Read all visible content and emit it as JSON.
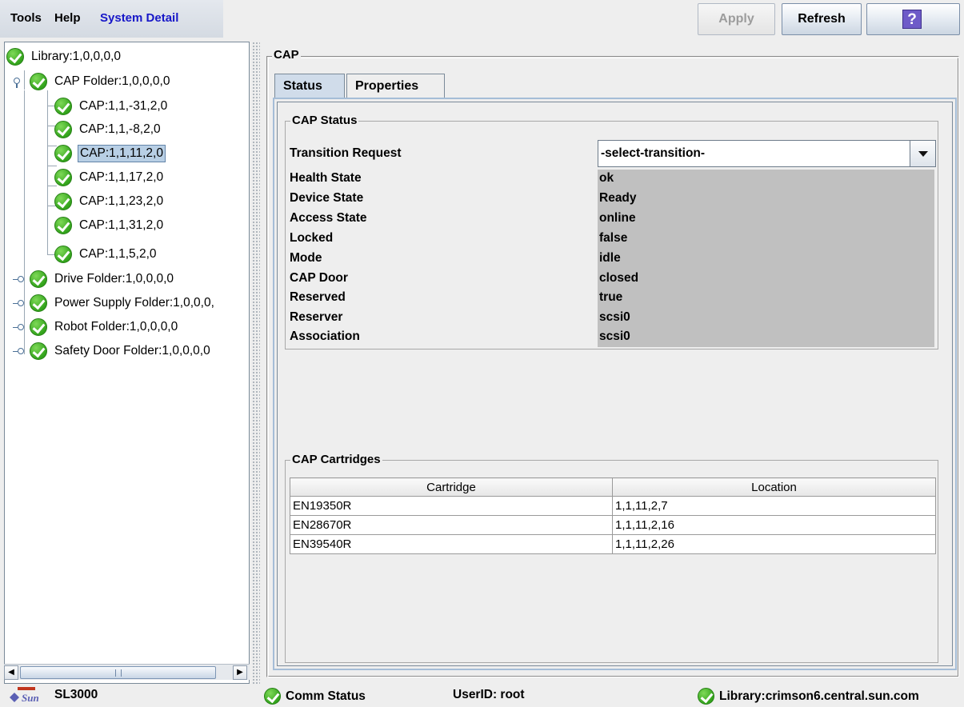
{
  "toolbar": {
    "menus": [
      "Tools",
      "Help",
      "System Detail"
    ],
    "apply_label": "Apply",
    "refresh_label": "Refresh",
    "help_glyph": "?"
  },
  "tree": {
    "items": [
      {
        "label": "Library:1,0,0,0,0",
        "status": "ok"
      },
      {
        "label": "CAP Folder:1,0,0,0,0",
        "status": "ok",
        "expanded": true
      },
      {
        "label": "CAP:1,1,-31,2,0",
        "status": "ok"
      },
      {
        "label": "CAP:1,1,-8,2,0",
        "status": "ok"
      },
      {
        "label": "CAP:1,1,11,2,0",
        "status": "ok",
        "selected": true
      },
      {
        "label": "CAP:1,1,17,2,0",
        "status": "ok"
      },
      {
        "label": "CAP:1,1,23,2,0",
        "status": "ok"
      },
      {
        "label": "CAP:1,1,31,2,0",
        "status": "ok"
      },
      {
        "label": "CAP:1,1,5,2,0",
        "status": "ok"
      },
      {
        "label": "Drive Folder:1,0,0,0,0",
        "status": "ok"
      },
      {
        "label": "Power Supply Folder:1,0,0,0,",
        "status": "ok"
      },
      {
        "label": "Robot Folder:1,0,0,0,0",
        "status": "ok"
      },
      {
        "label": "Safety Door Folder:1,0,0,0,0",
        "status": "ok"
      }
    ]
  },
  "detail": {
    "group_title": "CAP",
    "tabs": [
      {
        "label": "Status",
        "active": true
      },
      {
        "label": "Properties",
        "active": false
      }
    ],
    "status_group_title": "CAP Status",
    "transition_label": "Transition Request",
    "transition_value": "-select-transition-",
    "fields": [
      {
        "label": "Health State",
        "value": "ok"
      },
      {
        "label": "Device State",
        "value": "Ready"
      },
      {
        "label": "Access State",
        "value": "online"
      },
      {
        "label": "Locked",
        "value": "false"
      },
      {
        "label": "Mode",
        "value": "idle"
      },
      {
        "label": "CAP Door",
        "value": "closed"
      },
      {
        "label": "Reserved",
        "value": "true"
      },
      {
        "label": "Reserver",
        "value": "scsi0"
      },
      {
        "label": "Association",
        "value": "scsi0"
      }
    ],
    "cartridges_group_title": "CAP Cartridges",
    "cartridges_columns": [
      "Cartridge",
      "Location"
    ],
    "cartridges_rows": [
      [
        "EN19350R",
        "1,1,11,2,7"
      ],
      [
        "EN28670R",
        "1,1,11,2,16"
      ],
      [
        "EN39540R",
        "1,1,11,2,26"
      ]
    ]
  },
  "statusbar": {
    "logo_text": "Sun",
    "product": "SL3000",
    "comm_status": "Comm Status",
    "user": "UserID: root",
    "library": "Library:crimson6.central.sun.com"
  },
  "colors": {
    "accent_menu": "#1717c8",
    "ok_green": "#33a31c",
    "selection": "#b8cfe5",
    "help_purple": "#6e5bc8"
  }
}
